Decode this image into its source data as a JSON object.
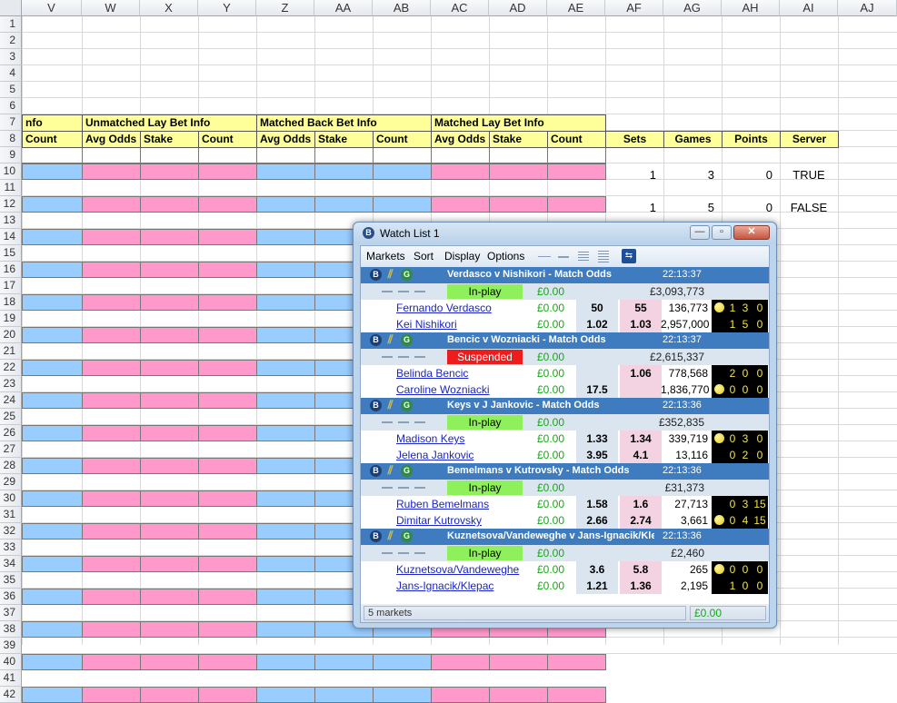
{
  "spreadsheet": {
    "columns": [
      "V",
      "W",
      "X",
      "Y",
      "Z",
      "AA",
      "AB",
      "AC",
      "AD",
      "AE",
      "AF",
      "AG",
      "AH",
      "AI",
      "AJ"
    ],
    "rows": [
      "1",
      "2",
      "3",
      "4",
      "5",
      "6",
      "7",
      "8",
      "9",
      "10",
      "11",
      "12",
      "13",
      "14",
      "15",
      "16",
      "17",
      "18",
      "19",
      "20",
      "21",
      "22",
      "23",
      "24",
      "25",
      "26",
      "27",
      "28",
      "29",
      "30",
      "31",
      "32",
      "33",
      "34",
      "35",
      "36",
      "37",
      "38",
      "39",
      "40",
      "41",
      "42"
    ],
    "groups": {
      "info": "nfo",
      "unmatched_lay": "Unmatched Lay Bet Info",
      "matched_back": "Matched Back Bet Info",
      "matched_lay": "Matched Lay Bet Info"
    },
    "subheaders": {
      "v": "Count",
      "w": "Avg Odds",
      "x": "Stake",
      "y": "Count",
      "z": "Avg Odds",
      "aa": "Stake",
      "ab": "Count",
      "ac": "Avg Odds",
      "ad": "Stake",
      "ae": "Count",
      "af": "Sets",
      "ag": "Games",
      "ah": "Points",
      "ai": "Server"
    },
    "row10": {
      "sets": "1",
      "games": "3",
      "points": "0",
      "server": "TRUE"
    },
    "row12": {
      "sets": "1",
      "games": "5",
      "points": "0",
      "server": "FALSE"
    },
    "colors": {
      "blue": "#99ccff",
      "pink": "#ff99cc",
      "yellow": "#ffff99"
    }
  },
  "watchlist": {
    "title": "Watch List 1",
    "menu": [
      "Markets",
      "Sort",
      "Display",
      "Options"
    ],
    "markets": [
      {
        "name": "Verdasco v Nishikori - Match Odds",
        "time": "22:13:37",
        "status": "In-play",
        "status_type": "inplay",
        "pl": "£0.00",
        "matched": "£3,093,773",
        "runners": [
          {
            "first": "Fernando",
            "last": "Verdasco",
            "pl": "£0.00",
            "back": "50",
            "lay": "55",
            "volume": "136,773",
            "serve": true,
            "sets": "1",
            "games": "3",
            "points": "0"
          },
          {
            "first": "Kei",
            "last": "Nishikori",
            "pl": "£0.00",
            "back": "1.02",
            "lay": "1.03",
            "volume": "2,957,000",
            "serve": false,
            "sets": "1",
            "games": "5",
            "points": "0"
          }
        ]
      },
      {
        "name": "Bencic v Wozniacki - Match Odds",
        "time": "22:13:37",
        "status": "Suspended",
        "status_type": "susp",
        "pl": "£0.00",
        "matched": "£2,615,337",
        "runners": [
          {
            "first": "Belinda",
            "last": "Bencic",
            "pl": "£0.00",
            "back": "",
            "lay": "1.06",
            "volume": "778,568",
            "serve": false,
            "sets": "2",
            "games": "0",
            "points": "0"
          },
          {
            "first": "Caroline",
            "last": "Wozniacki",
            "pl": "£0.00",
            "back": "17.5",
            "lay": "",
            "volume": "1,836,770",
            "serve": true,
            "sets": "0",
            "games": "0",
            "points": "0"
          }
        ]
      },
      {
        "name": "Keys v J Jankovic - Match Odds",
        "time": "22:13:36",
        "status": "In-play",
        "status_type": "inplay",
        "pl": "£0.00",
        "matched": "£352,835",
        "runners": [
          {
            "first": "Madison",
            "last": "Keys",
            "pl": "£0.00",
            "back": "1.33",
            "lay": "1.34",
            "volume": "339,719",
            "serve": true,
            "sets": "0",
            "games": "3",
            "points": "0"
          },
          {
            "first": "Jelena",
            "last": "Jankovic",
            "pl": "£0.00",
            "back": "3.95",
            "lay": "4.1",
            "volume": "13,116",
            "serve": false,
            "sets": "0",
            "games": "2",
            "points": "0"
          }
        ]
      },
      {
        "name": "Bemelmans v Kutrovsky - Match Odds",
        "time": "22:13:36",
        "status": "In-play",
        "status_type": "inplay",
        "pl": "£0.00",
        "matched": "£31,373",
        "runners": [
          {
            "first": "Ruben",
            "last": "Bemelmans",
            "pl": "£0.00",
            "back": "1.58",
            "lay": "1.6",
            "volume": "27,713",
            "serve": false,
            "sets": "0",
            "games": "3",
            "points": "15"
          },
          {
            "first": "Dimitar",
            "last": "Kutrovsky",
            "pl": "£0.00",
            "back": "2.66",
            "lay": "2.74",
            "volume": "3,661",
            "serve": true,
            "sets": "0",
            "games": "4",
            "points": "15"
          }
        ]
      },
      {
        "name": "Kuznetsova/Vandeweghe v Jans-Ignacik/Klepac - Match Odds",
        "time": "22:13:36",
        "status": "In-play",
        "status_type": "inplay",
        "pl": "£0.00",
        "matched": "£2,460",
        "runners": [
          {
            "first": "",
            "last": "Kuznetsova/Vandeweghe",
            "pl": "£0.00",
            "back": "3.6",
            "lay": "5.8",
            "volume": "265",
            "serve": true,
            "sets": "0",
            "games": "0",
            "points": "0"
          },
          {
            "first": "",
            "last": "Jans-Ignacik/Klepac",
            "pl": "£0.00",
            "back": "1.21",
            "lay": "1.36",
            "volume": "2,195",
            "serve": false,
            "sets": "1",
            "games": "0",
            "points": "0"
          }
        ]
      }
    ],
    "status_left": "5 markets",
    "status_right": "£0.00",
    "colors": {
      "header": "#3f7cbf",
      "inplay": "#8ef05a",
      "suspended": "#ee1c1c",
      "pl_green": "#17a617"
    }
  }
}
